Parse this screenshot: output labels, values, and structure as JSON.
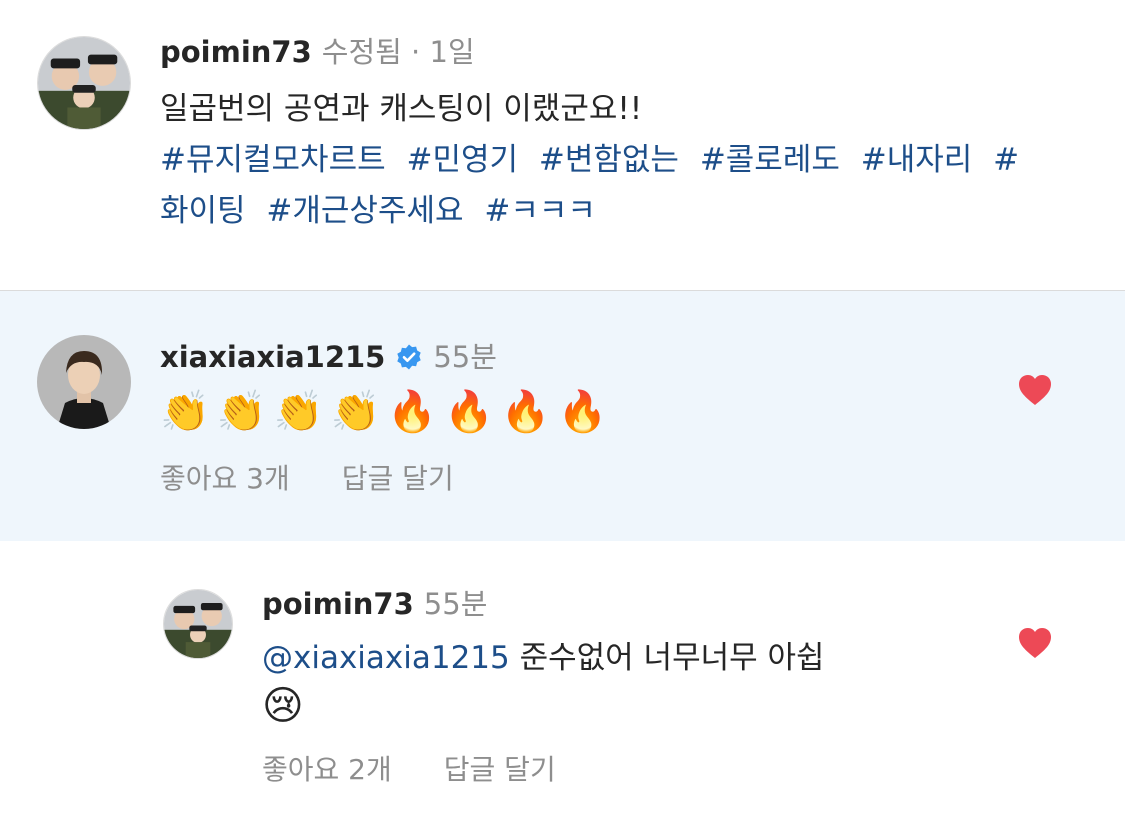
{
  "caption": {
    "username": "poimin73",
    "meta": "수정됨 · 1일",
    "text": "일곱번의 공연과 캐스팅이 이랬군요!!",
    "hashtags": [
      "#뮤지컬모차르트",
      "#민영기",
      "#변함없는",
      "#콜로레도",
      "#내자리",
      "#화이팅",
      "#개근상주세요",
      "#ㅋㅋㅋ"
    ]
  },
  "comment1": {
    "username": "xiaxiaxia1215",
    "verified": true,
    "time": "55분",
    "emojis": [
      "👏",
      "👏",
      "👏",
      "👏",
      "🔥",
      "🔥",
      "🔥",
      "🔥"
    ],
    "likes": "좋아요 3개",
    "reply_label": "답글 달기",
    "liked": true,
    "heart_color": "#ed4956"
  },
  "reply1": {
    "username": "poimin73",
    "time": "55분",
    "mention": "@xiaxiaxia1215",
    "text": "준수없어 너무너무 아쉽",
    "emoji": "😢",
    "likes": "좋아요 2개",
    "reply_label": "답글 달기",
    "liked": true,
    "heart_color": "#ed4956"
  },
  "colors": {
    "highlight_bg": "#eff6fc",
    "link": "#1d4e89",
    "muted": "#8e8e8e",
    "verified_badge": "#3897f0"
  }
}
